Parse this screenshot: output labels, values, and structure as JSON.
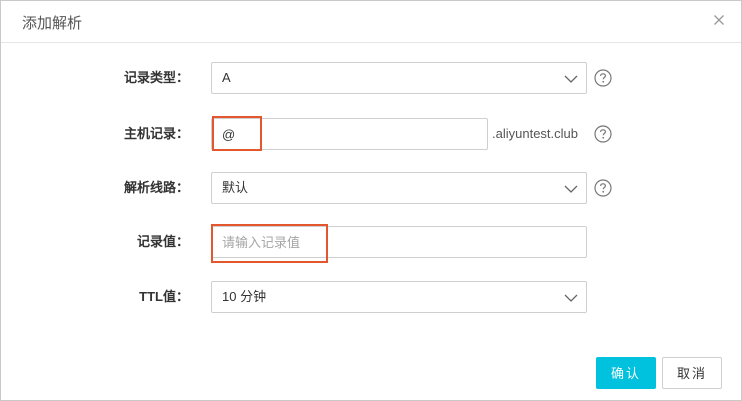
{
  "dialog": {
    "title": "添加解析",
    "close_icon": "close-icon"
  },
  "form": {
    "record_type": {
      "label": "记录类型：",
      "value": "A"
    },
    "host_record": {
      "label": "主机记录：",
      "value": "@",
      "suffix": ".aliyuntest.club"
    },
    "line": {
      "label": "解析线路：",
      "value": "默认"
    },
    "record_value": {
      "label": "记录值：",
      "value": "",
      "placeholder": "请输入记录值"
    },
    "ttl": {
      "label": "TTL值：",
      "value": "10 分钟"
    }
  },
  "footer": {
    "confirm_label": "确认",
    "cancel_label": "取消"
  },
  "colors": {
    "primary": "#00c1de",
    "highlight": "#e4572e"
  }
}
